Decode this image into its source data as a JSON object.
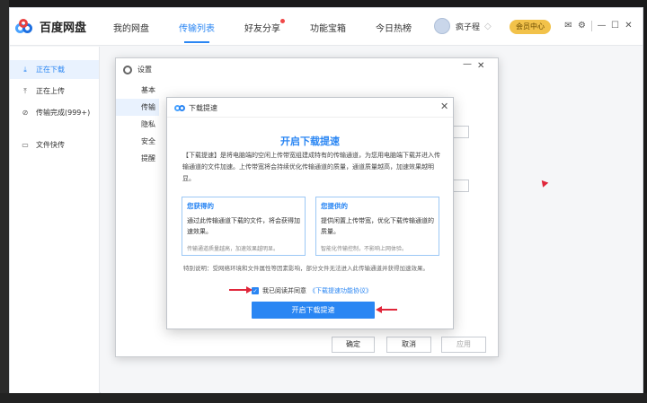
{
  "app": {
    "logo_text": "百度网盘",
    "nav": [
      "我的网盘",
      "传输列表",
      "好友分享",
      "功能宝箱",
      "今日热榜"
    ],
    "username": "疯子程",
    "vip_label": "会员中心"
  },
  "sidebar": {
    "items": [
      {
        "label": "正在下载",
        "icon": "download-icon"
      },
      {
        "label": "正在上传",
        "icon": "upload-icon"
      },
      {
        "label": "传输完成(999+)",
        "icon": "check-circle-icon"
      },
      {
        "label": "文件快传",
        "icon": "monitor-icon"
      }
    ]
  },
  "settings": {
    "title": "设置",
    "nav": [
      "基本",
      "传输",
      "隐私",
      "安全",
      "提醒"
    ],
    "ok_label": "确定",
    "cancel_label": "取消",
    "apply_label": "应用"
  },
  "accel": {
    "header_title": "下载提速",
    "title": "开启下载提速",
    "description": "【下载提速】是将电脑端的空闲上传带宽组建成特有的传输通道，为您用电脑端下载并进入传输通道的文件加速。上传带宽将会持续优化传输通道的质量，通道质量越高，加速效果越明显。",
    "benefit_get": {
      "title": "您获得的",
      "body": "通过此传输通道下载的文件，将会获得加速效果。",
      "note": "传输通道质量越高，加速效果越明显。"
    },
    "benefit_give": {
      "title": "您提供的",
      "body": "提供闲置上传带宽，优化下载传输通道的质量。",
      "note": "智能化传输控制，不影响上网体验。"
    },
    "special_note": "特别说明：受网络环境和文件属性等因素影响，部分文件无法进入此传输通道并获得加速效果。",
    "agree_text": "我已阅读并同意",
    "agree_link": "《下载提速功能协议》",
    "start_button": "开启下载提速"
  },
  "colors": {
    "accent": "#2a86f3",
    "vip": "#f2c24a",
    "annotation": "#e0263a"
  }
}
